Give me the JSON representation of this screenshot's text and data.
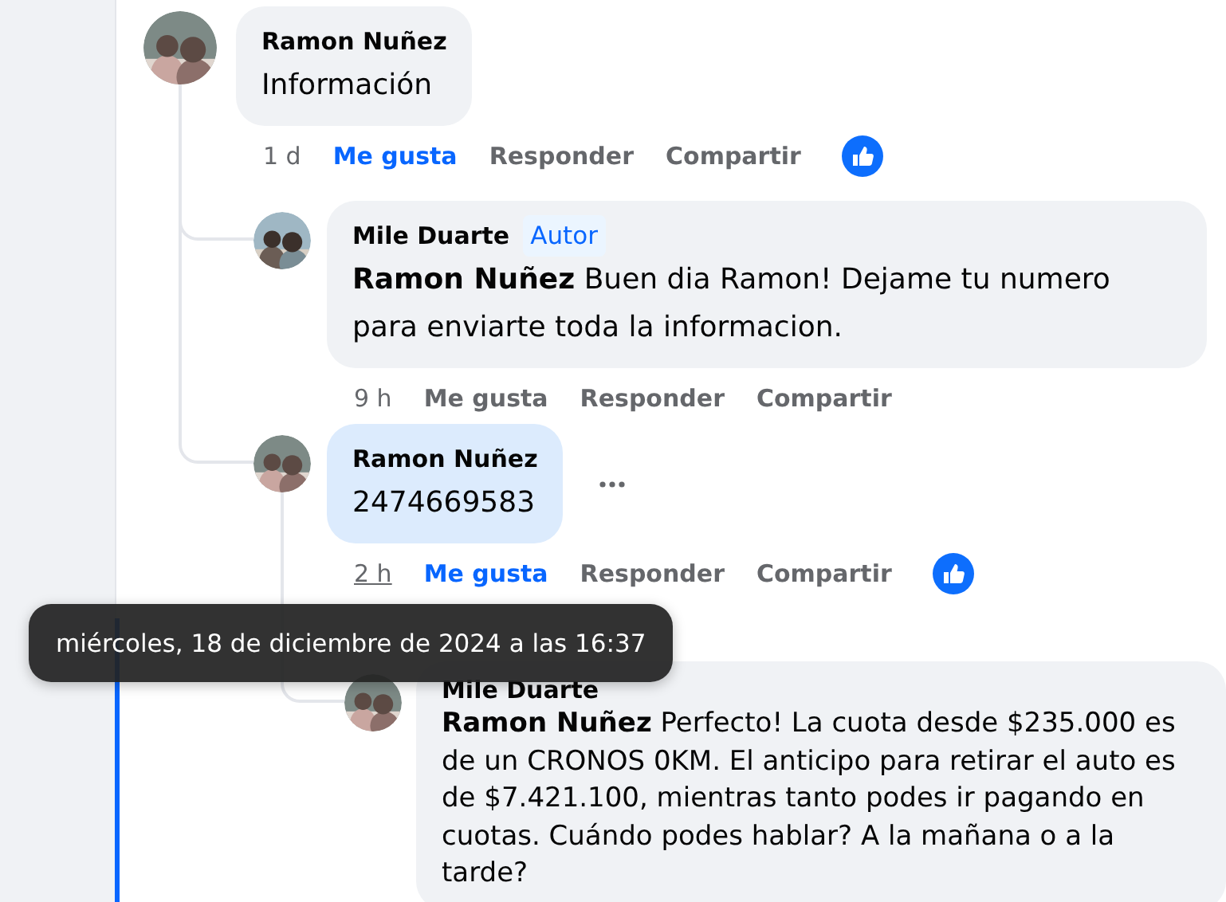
{
  "comments": [
    {
      "author": "Ramon Nuñez",
      "text": "Información",
      "time": "1 d",
      "time_hovered": false,
      "like_label": "Me gusta",
      "liked": true,
      "reply_label": "Responder",
      "share_label": "Compartir",
      "reaction": true,
      "children": [
        {
          "author": "Mile Duarte",
          "badge": "Autor",
          "text": "**Ramon Nuñez** Buen dia Ramon! Dejame tu numero para enviarte toda la informacion.",
          "highlighted": false,
          "time": "9 h",
          "time_hovered": false,
          "like_label": "Me gusta",
          "liked": false,
          "reply_label": "Responder",
          "share_label": "Compartir",
          "reaction": false
        },
        {
          "author": "Ramon Nuñez",
          "text": "2474669583",
          "highlighted": true,
          "menu_button": true,
          "time": "2 h",
          "time_hovered": true,
          "like_label": "Me gusta",
          "liked": true,
          "reply_label": "Responder",
          "share_label": "Compartir",
          "reaction": true,
          "children": [
            {
              "author": "Mile Duarte",
              "text": "**Ramon Nuñez** Perfecto! La cuota desde $235.000 es de un CRONOS 0KM. El anticipo para retirar el auto es de $7.421.100, mientras tanto podes ir pagando en cuotas. Cuándo podes hablar? A la mañana o a la tarde?",
              "highlighted": false
            }
          ]
        }
      ]
    }
  ],
  "tooltip": {
    "text": "miércoles, 18 de diciembre de 2024 a las 16:37"
  }
}
